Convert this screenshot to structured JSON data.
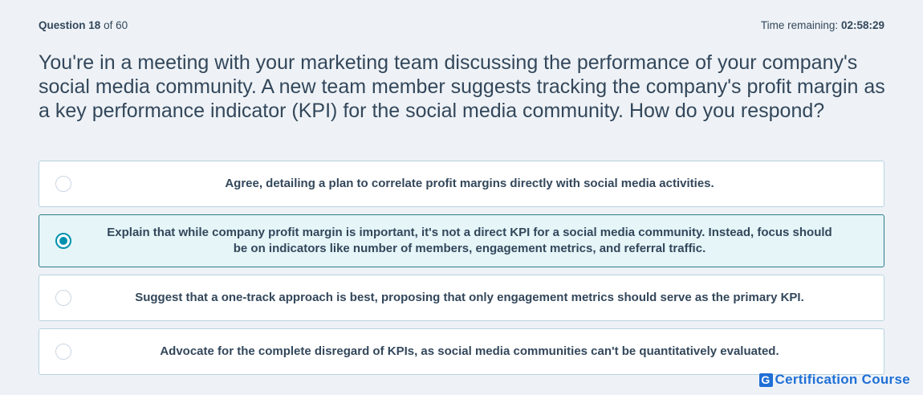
{
  "header": {
    "question_label": "Question",
    "question_number": "18",
    "of_text": "of 60",
    "time_label": "Time remaining:",
    "time_value": "02:58:29"
  },
  "question": {
    "text": "You're in a meeting with your marketing team discussing the performance of your company's social media community. A new team member suggests tracking the company's profit margin as a key performance indicator (KPI) for the social media community. How do you respond?"
  },
  "options": [
    {
      "text": "Agree, detailing a plan to correlate profit margins directly with social media activities.",
      "selected": false
    },
    {
      "text": "Explain that while company profit margin is important, it's not a direct KPI for a social media community. Instead, focus should be on indicators like number of members, engagement metrics, and referral traffic.",
      "selected": true
    },
    {
      "text": "Suggest that a one-track approach is best, proposing that only engagement metrics should serve as the primary KPI.",
      "selected": false
    },
    {
      "text": "Advocate for the complete disregard of KPIs, as social media communities can't be quantitatively evaluated.",
      "selected": false
    }
  ],
  "brand": {
    "logo_letter": "G",
    "name": "Certification Course",
    "color": "#1f6fd6"
  },
  "colors": {
    "selected_accent": "#0091ae",
    "selected_background": "#e5f5f8"
  }
}
